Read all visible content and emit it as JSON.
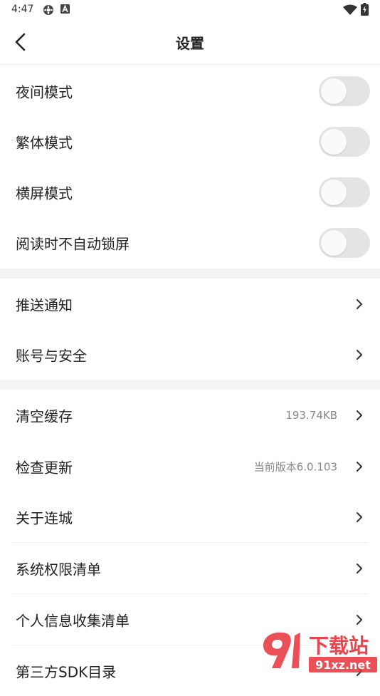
{
  "status_bar": {
    "time": "4:47",
    "icons": [
      "settings-gear-icon",
      "notification-a-icon",
      "wifi-icon",
      "battery-icon"
    ]
  },
  "header": {
    "title": "设置",
    "back_icon": "chevron-left-icon"
  },
  "toggles": [
    {
      "label": "夜间模式",
      "on": false
    },
    {
      "label": "繁体模式",
      "on": false
    },
    {
      "label": "横屏模式",
      "on": false
    },
    {
      "label": "阅读时不自动锁屏",
      "on": false
    }
  ],
  "group2": [
    {
      "label": "推送通知"
    },
    {
      "label": "账号与安全"
    }
  ],
  "group3": [
    {
      "label": "清空缓存",
      "value": "193.74KB"
    },
    {
      "label": "检查更新",
      "value": "当前版本6.0.103"
    },
    {
      "label": "关于连城"
    },
    {
      "label": "系统权限清单"
    },
    {
      "label": "个人信息收集清单"
    },
    {
      "label": "第三方SDK目录"
    }
  ],
  "watermark": {
    "logo_text": "下载站",
    "domain": "91xz.net",
    "colors": {
      "red": "#e8313a"
    }
  }
}
